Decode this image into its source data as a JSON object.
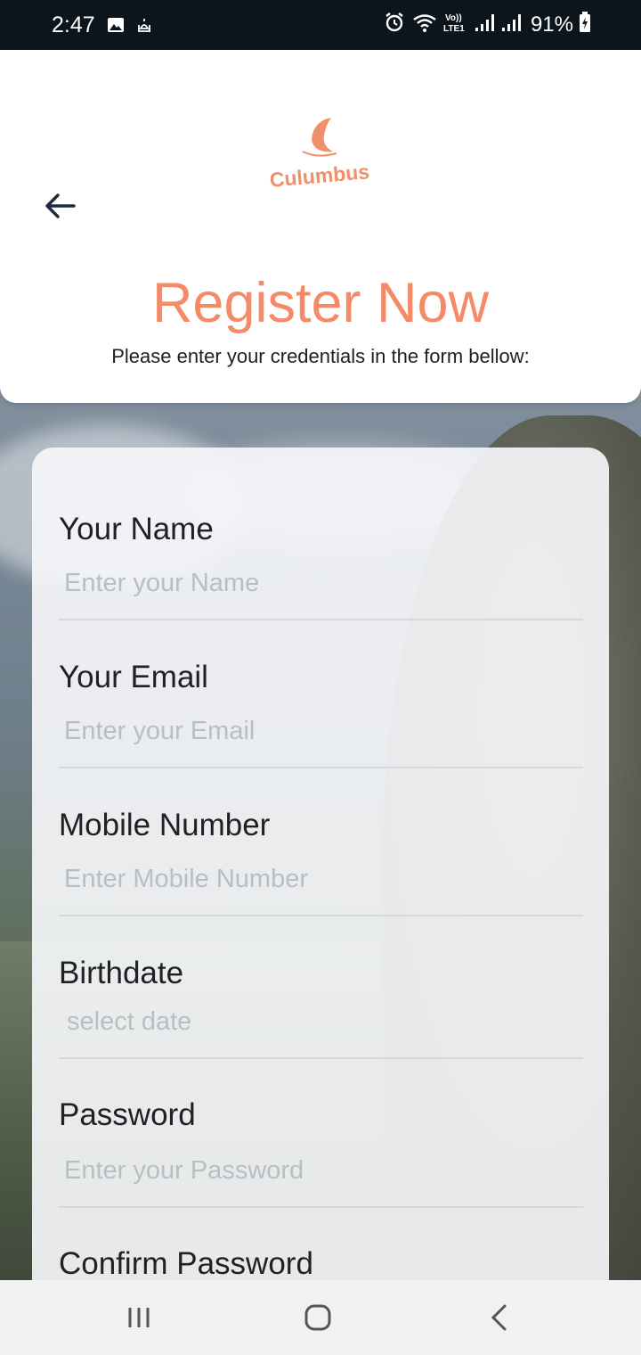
{
  "status_bar": {
    "time": "2:47",
    "battery_percent": "91%",
    "icons": [
      "gallery-icon",
      "mosque-icon",
      "alarm-icon",
      "wifi-icon",
      "volte-icon",
      "signal-icon",
      "signal-icon",
      "battery-charging-icon"
    ]
  },
  "header": {
    "back_icon": "arrow-left-icon",
    "logo_text": "Culumbus",
    "title": "Register Now",
    "subtitle": "Please enter your credentials in the form bellow:"
  },
  "form": {
    "fields": [
      {
        "label": "Your Name",
        "placeholder": "Enter your Name"
      },
      {
        "label": "Your Email",
        "placeholder": "Enter your Email"
      },
      {
        "label": "Mobile Number",
        "placeholder": "Enter Mobile Number"
      },
      {
        "label": "Birthdate",
        "placeholder": "select date"
      },
      {
        "label": "Password",
        "placeholder": "Enter your Password"
      },
      {
        "label": "Confirm Password",
        "placeholder": ""
      }
    ]
  },
  "nav_bar": {
    "icons": [
      "recents-icon",
      "home-icon",
      "back-icon"
    ]
  },
  "colors": {
    "accent": "#f58a66",
    "logo": "#f0906a",
    "status_bar_bg": "#0c141c",
    "back_arrow": "#1e2a44"
  }
}
